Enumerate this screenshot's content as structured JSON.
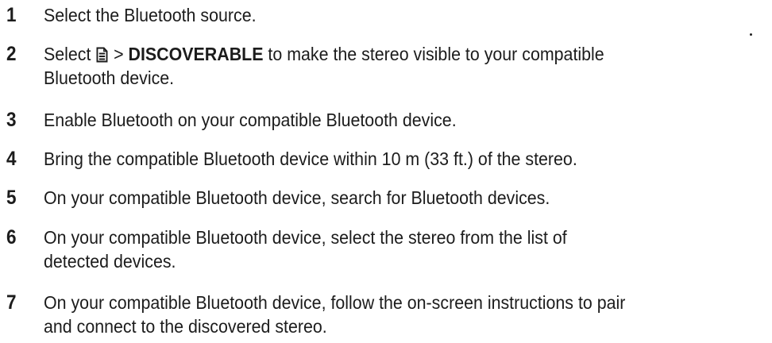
{
  "steps": [
    {
      "number": "1",
      "text": "Select the Bluetooth source."
    },
    {
      "number": "2",
      "select_word": "Select",
      "icon": "menu-list-icon",
      "separator": ">",
      "option": "DISCOVERABLE",
      "text_rest": "to make the stereo visible to your compatible",
      "line2": "Bluetooth device."
    },
    {
      "number": "3",
      "text": "Enable Bluetooth on your compatible Bluetooth device."
    },
    {
      "number": "4",
      "text": "Bring the compatible Bluetooth device within 10 m (33 ft.) of the stereo."
    },
    {
      "number": "5",
      "text": "On your compatible Bluetooth device, search for Bluetooth devices."
    },
    {
      "number": "6",
      "line1": "On your compatible Bluetooth device, select the stereo from the list of",
      "line2": "detected devices."
    },
    {
      "number": "7",
      "line1": "On your compatible Bluetooth device, follow the on-screen instructions to pair",
      "line2": "and connect to the discovered stereo."
    }
  ]
}
